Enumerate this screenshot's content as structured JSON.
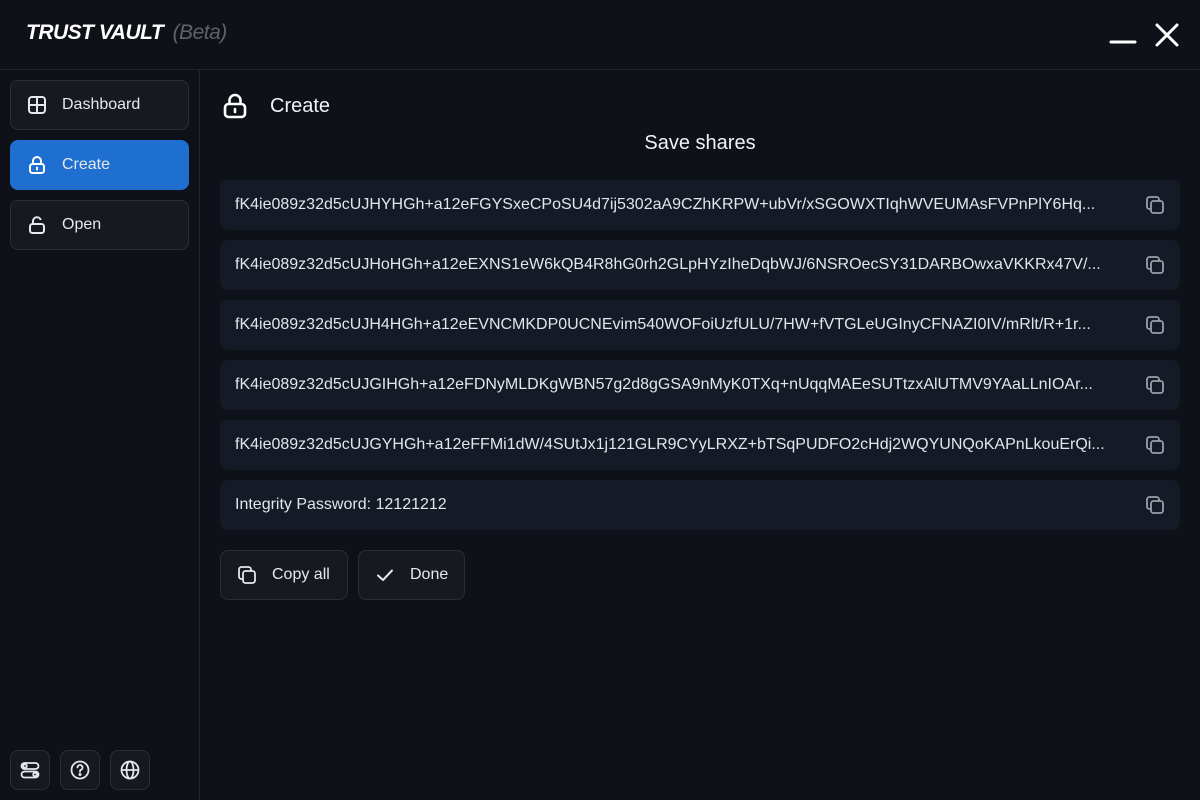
{
  "app": {
    "title": "TRUST VAULT",
    "beta_label": "(Beta)"
  },
  "sidebar": {
    "items": [
      {
        "label": "Dashboard",
        "icon": "grid-icon",
        "active": false
      },
      {
        "label": "Create",
        "icon": "lock-icon",
        "active": true
      },
      {
        "label": "Open",
        "icon": "unlock-icon",
        "active": false
      }
    ],
    "bottom_buttons": [
      {
        "icon": "settings-toggle-icon"
      },
      {
        "icon": "help-icon"
      },
      {
        "icon": "globe-icon"
      }
    ]
  },
  "main": {
    "header": {
      "title": "Create",
      "icon": "lock-icon"
    },
    "section_title": "Save shares",
    "shares": [
      "fK4ie089z32d5cUJHYHGh+a12eFGYSxeCPoSU4d7ij5302aA9CZhKRPW+ubVr/xSGOWXTIqhWVEUMAsFVPnPlY6Hq...",
      "fK4ie089z32d5cUJHoHGh+a12eEXNS1eW6kQB4R8hG0rh2GLpHYzIheDqbWJ/6NSROecSY31DARBOwxaVKKRx47V/...",
      "fK4ie089z32d5cUJH4HGh+a12eEVNCMKDP0UCNEvim540WOFoiUzfULU/7HW+fVTGLeUGInyCFNAZI0IV/mRlt/R+1r...",
      "fK4ie089z32d5cUJGIHGh+a12eFDNyMLDKgWBN57g2d8gGSA9nMyK0TXq+nUqqMAEeSUTtzxAlUTMV9YAaLLnIOAr...",
      "fK4ie089z32d5cUJGYHGh+a12eFFMi1dW/4SUtJx1j121GLR9CYyLRXZ+bTSqPUDFO2cHdj2WQYUNQoKAPnLkouErQi..."
    ],
    "integrity": "Integrity Password: 12121212",
    "buttons": {
      "copy_all": "Copy all",
      "done": "Done"
    }
  },
  "colors": {
    "accent": "#1f6fd1",
    "background": "#0e1117",
    "row_bg": "#141b26"
  }
}
